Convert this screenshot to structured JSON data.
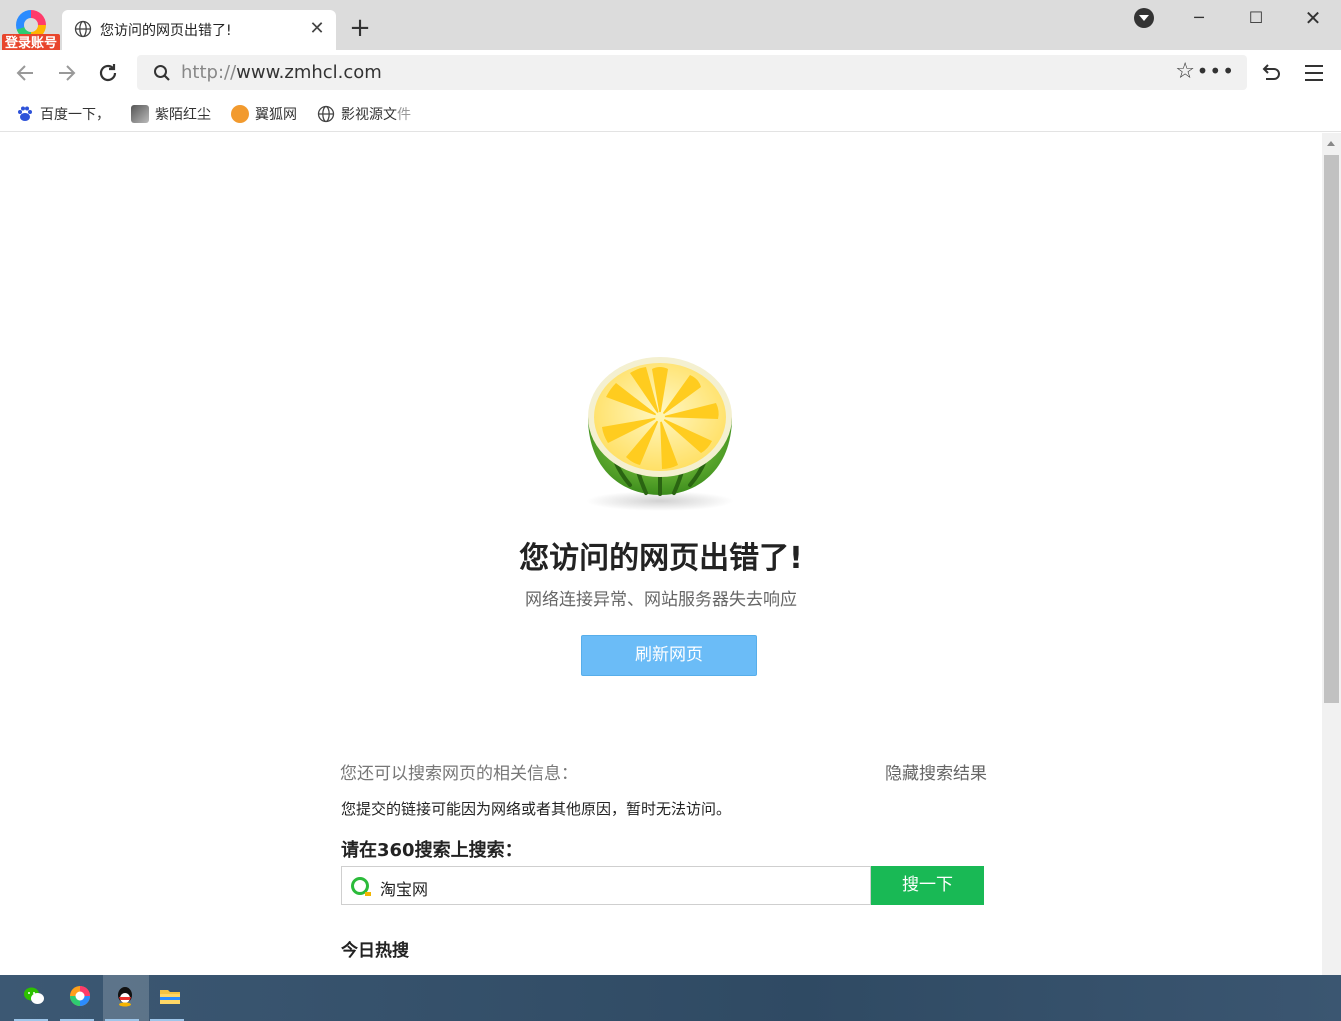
{
  "browser": {
    "account_badge": "登录账号",
    "tab_title": "您访问的网页出错了!",
    "url_scheme": "http://",
    "url_rest": "www.zmhcl.com",
    "icons": {
      "back": "back-arrow-icon",
      "forward": "forward-arrow-icon",
      "reload": "reload-icon",
      "star": "star-icon",
      "more": "more-icon",
      "undo": "undo-icon",
      "menu": "hamburger-menu-icon"
    }
  },
  "bookmarks": [
    {
      "label": "百度一下，",
      "icon": "baidu-icon"
    },
    {
      "label": "紫陌红尘",
      "icon": "site-icon"
    },
    {
      "label": "翼狐网",
      "icon": "yihu-icon"
    },
    {
      "label": "影视源文",
      "suffix": "件",
      "icon": "globe-icon"
    }
  ],
  "error_page": {
    "title": "您访问的网页出错了!",
    "subtitle": "网络连接异常、网站服务器失去响应",
    "refresh_label": "刷新网页",
    "hint": "您还可以搜索网页的相关信息：",
    "hide_results": "隐藏搜索结果",
    "reason": "您提交的链接可能因为网络或者其他原因，暂时无法访问。",
    "search_label": "请在360搜索上搜索：",
    "search_value": "淘宝网",
    "search_button": "搜一下",
    "hot_title": "今日热搜"
  },
  "colors": {
    "refresh_button": "#6bbcf7",
    "search_button": "#19b955",
    "account_badge": "#e8452c"
  }
}
